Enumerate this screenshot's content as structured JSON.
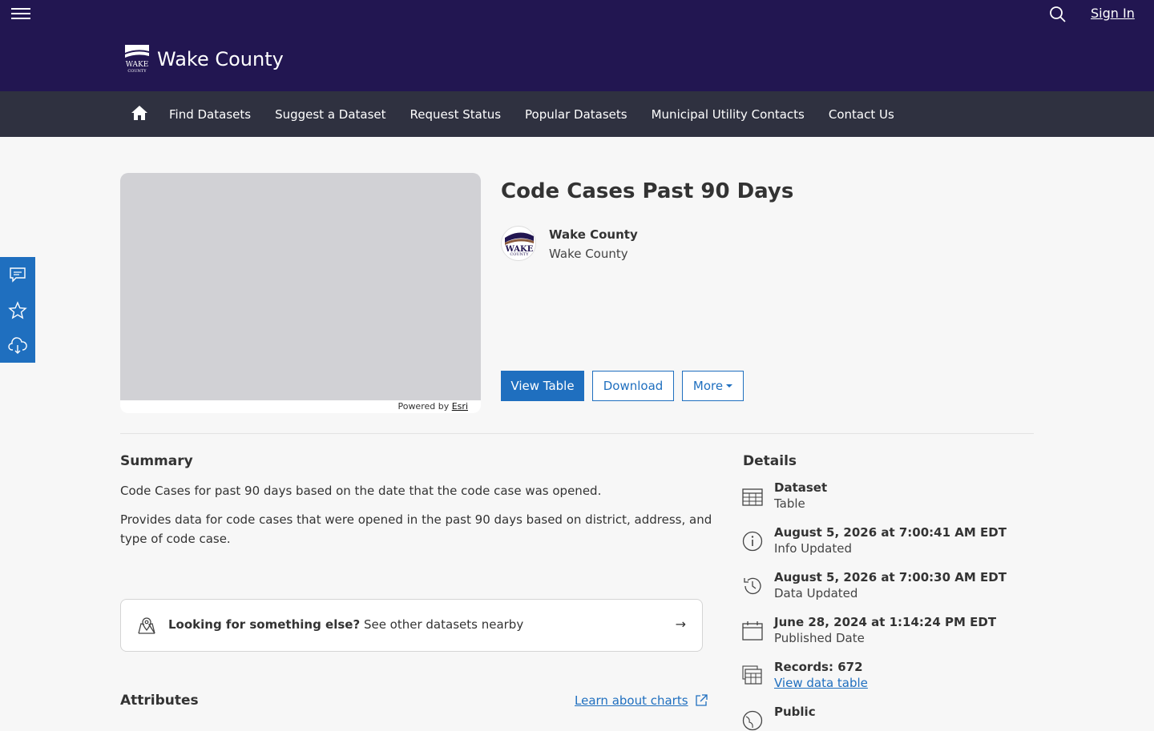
{
  "header": {
    "site_title": "Wake County",
    "sign_in": "Sign In",
    "logo_text": "WAKE COUNTY"
  },
  "nav": {
    "items": [
      "Find Datasets",
      "Suggest a Dataset",
      "Request Status",
      "Popular Datasets",
      "Municipal Utility Contacts",
      "Contact Us"
    ]
  },
  "map": {
    "powered_by": "Powered by",
    "powered_link": "Esri"
  },
  "dataset": {
    "title": "Code Cases Past 90 Days",
    "org_name": "Wake County",
    "org_sub": "Wake County",
    "btn_view_table": "View Table",
    "btn_download": "Download",
    "btn_more": "More"
  },
  "summary": {
    "heading": "Summary",
    "line1": "Code Cases for past 90 days based on the date that the code case was opened.",
    "line2a": "Provides data for code cases that were opened in the past 90 days based on district, address, and",
    "line2b": "type of code case."
  },
  "nearby": {
    "bold": "Looking for something else?",
    "rest": " See other datasets nearby",
    "arrow": "→"
  },
  "attributes": {
    "heading": "Attributes",
    "learn": "Learn about charts"
  },
  "details": {
    "heading": "Details",
    "items": [
      {
        "main": "Dataset",
        "sub": "Table"
      },
      {
        "main": "August 5, 2026 at 7:00:41 AM EDT",
        "sub": "Info Updated"
      },
      {
        "main": "August 5, 2026 at 7:00:30 AM EDT",
        "sub": "Data Updated"
      },
      {
        "main": "June 28, 2024 at 1:14:24 PM EDT",
        "sub": "Published Date"
      },
      {
        "main": "Records: 672",
        "sub": "View data table"
      },
      {
        "main": "Public",
        "sub": ""
      }
    ]
  },
  "colors": {
    "header_bg": "#221651",
    "nav_bg": "#2f3140",
    "accent": "#1f6fbf"
  }
}
